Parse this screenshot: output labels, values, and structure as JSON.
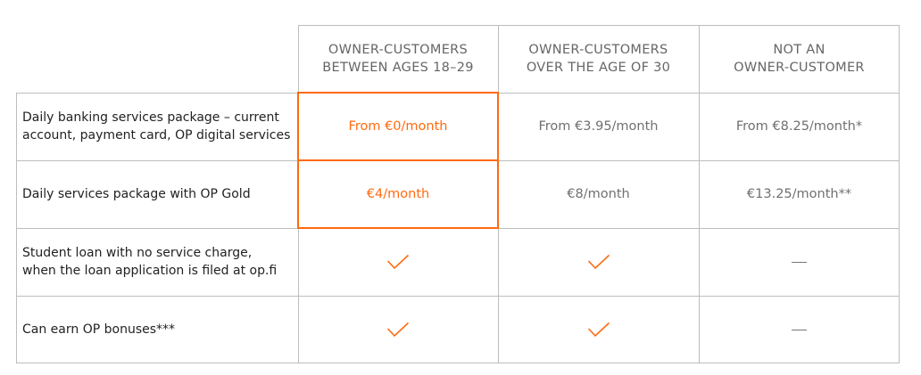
{
  "table": {
    "columns": [
      {
        "header": "OWNER-CUSTOMERS\nBETWEEN AGES 18–29"
      },
      {
        "header": "OWNER-CUSTOMERS\nOVER THE AGE OF 30"
      },
      {
        "header": "NOT AN\nOWNER-CUSTOMER"
      }
    ],
    "rows": [
      {
        "label": "Daily banking services package – current\naccount, payment card, OP digital services",
        "cells": [
          {
            "type": "text",
            "value": "From €0/month",
            "highlight": true
          },
          {
            "type": "text",
            "value": "From €3.95/month"
          },
          {
            "type": "text",
            "value": "From €8.25/month*"
          }
        ]
      },
      {
        "label": "Daily services package with OP Gold",
        "cells": [
          {
            "type": "text",
            "value": "€4/month",
            "highlight": true
          },
          {
            "type": "text",
            "value": "€8/month"
          },
          {
            "type": "text",
            "value": "€13.25/month**"
          }
        ]
      },
      {
        "label": "Student loan with no service charge,\nwhen the loan application is filed at op.fi",
        "cells": [
          {
            "type": "icon",
            "icon": "check-icon"
          },
          {
            "type": "icon",
            "icon": "check-icon"
          },
          {
            "type": "icon",
            "icon": "dash-icon"
          }
        ]
      },
      {
        "label": "Can earn OP bonuses***",
        "cells": [
          {
            "type": "icon",
            "icon": "check-icon"
          },
          {
            "type": "icon",
            "icon": "check-icon"
          },
          {
            "type": "icon",
            "icon": "dash-icon"
          }
        ]
      }
    ]
  },
  "colors": {
    "accent": "#ff6a10",
    "grid": "#bdbdbd",
    "header_text": "#666666",
    "value_text": "#707070",
    "label_text": "#222222"
  }
}
